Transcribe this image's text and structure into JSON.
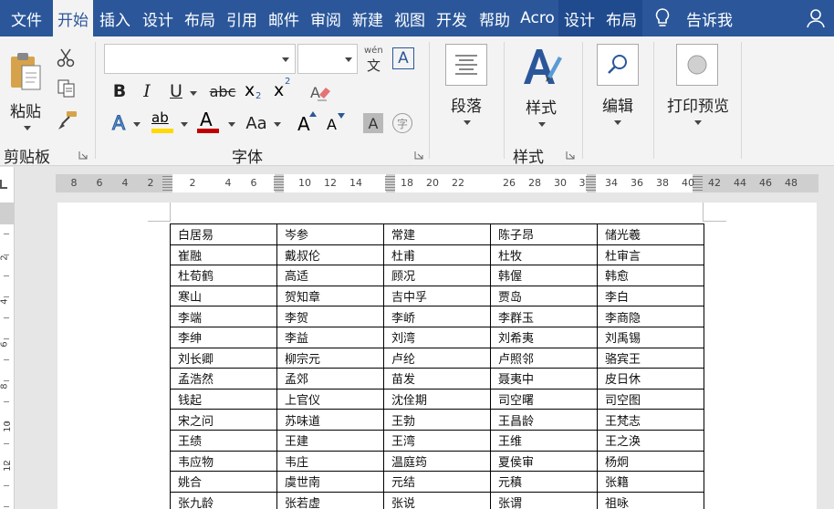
{
  "tabs": [
    {
      "label": "文件",
      "state": "normal"
    },
    {
      "label": "开始",
      "state": "active"
    },
    {
      "label": "插入",
      "state": "normal"
    },
    {
      "label": "设计",
      "state": "normal"
    },
    {
      "label": "布局",
      "state": "normal"
    },
    {
      "label": "引用",
      "state": "normal"
    },
    {
      "label": "邮件",
      "state": "normal"
    },
    {
      "label": "审阅",
      "state": "normal"
    },
    {
      "label": "新建",
      "state": "normal"
    },
    {
      "label": "视图",
      "state": "normal"
    },
    {
      "label": "开发",
      "state": "normal"
    },
    {
      "label": "帮助",
      "state": "normal"
    },
    {
      "label": "Acro",
      "state": "normal"
    },
    {
      "label": "设计",
      "state": "context"
    },
    {
      "label": "布局",
      "state": "context"
    }
  ],
  "tell_me": "告诉我",
  "ribbon": {
    "clipboard": {
      "paste_label": "粘贴",
      "group_label": "剪贴板"
    },
    "font": {
      "group_label": "字体",
      "font_name": "",
      "font_size": "",
      "phonetic_glyph": "wén",
      "bold": "B",
      "italic": "I",
      "underline": "U",
      "strike": "abc",
      "subscript": "x",
      "subscript_mark": "2",
      "superscript": "x",
      "superscript_mark": "2",
      "text_effect": "A",
      "highlight": "ab",
      "font_color": "A",
      "change_case": "Aa",
      "grow": "A",
      "shrink": "A",
      "shading": "A",
      "encircle": "字",
      "border_char": "A"
    },
    "paragraph": {
      "label": "段落"
    },
    "styles": {
      "label": "样式",
      "group_label": "样式"
    },
    "editing": {
      "label": "编辑"
    },
    "print_preview": {
      "label": "打印预览"
    }
  },
  "ruler_ticks": [
    "8",
    "6",
    "4",
    "2",
    "2",
    "4",
    "6",
    "10",
    "12",
    "14",
    "18",
    "20",
    "22",
    "26",
    "28",
    "30",
    "3",
    "34",
    "36",
    "38",
    "40",
    "42",
    "44",
    "46",
    "48"
  ],
  "vruler_ticks": [
    "2",
    "4",
    "6",
    "8",
    "10",
    "12"
  ],
  "table": [
    [
      "白居易",
      "岑参",
      "常建",
      "陈子昂",
      "储光羲"
    ],
    [
      "崔融",
      "戴叔伦",
      "杜甫",
      "杜牧",
      "杜审言"
    ],
    [
      "杜荀鹤",
      "高适",
      "顾况",
      "韩偓",
      "韩愈"
    ],
    [
      "寒山",
      "贺知章",
      "吉中孚",
      "贾岛",
      "李白"
    ],
    [
      "李端",
      "李贺",
      "李峤",
      "李群玉",
      "李商隐"
    ],
    [
      "李绅",
      "李益",
      "刘湾",
      "刘希夷",
      "刘禹锡"
    ],
    [
      "刘长卿",
      "柳宗元",
      "卢纶",
      "卢照邻",
      "骆宾王"
    ],
    [
      "孟浩然",
      "孟郊",
      "苗发",
      "聂夷中",
      "皮日休"
    ],
    [
      "钱起",
      "上官仪",
      "沈佺期",
      "司空曙",
      "司空图"
    ],
    [
      "宋之问",
      "苏味道",
      "王勃",
      "王昌龄",
      "王梵志"
    ],
    [
      "王绩",
      "王建",
      "王湾",
      "王维",
      "王之涣"
    ],
    [
      "韦应物",
      "韦庄",
      "温庭筠",
      "夏侯审",
      "杨炯"
    ],
    [
      "姚合",
      "虞世南",
      "元结",
      "元稹",
      "张籍"
    ],
    [
      "张九龄",
      "张若虚",
      "张说",
      "张谓",
      "祖咏"
    ]
  ],
  "colors": {
    "tab_bar": "#2b579a",
    "highlight": "#ffd900",
    "font_color": "#c00000"
  }
}
